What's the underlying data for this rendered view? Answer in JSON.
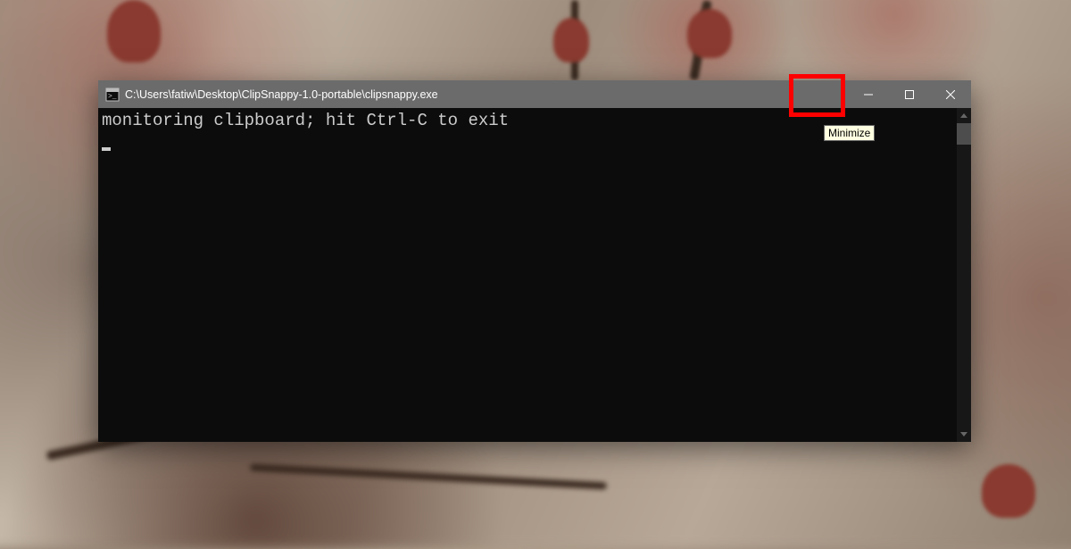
{
  "window": {
    "title": "C:\\Users\\fatiw\\Desktop\\ClipSnappy-1.0-portable\\clipsnappy.exe"
  },
  "terminal": {
    "line1": "monitoring clipboard; hit Ctrl-C to exit"
  },
  "tooltip": {
    "text": "Minimize"
  }
}
